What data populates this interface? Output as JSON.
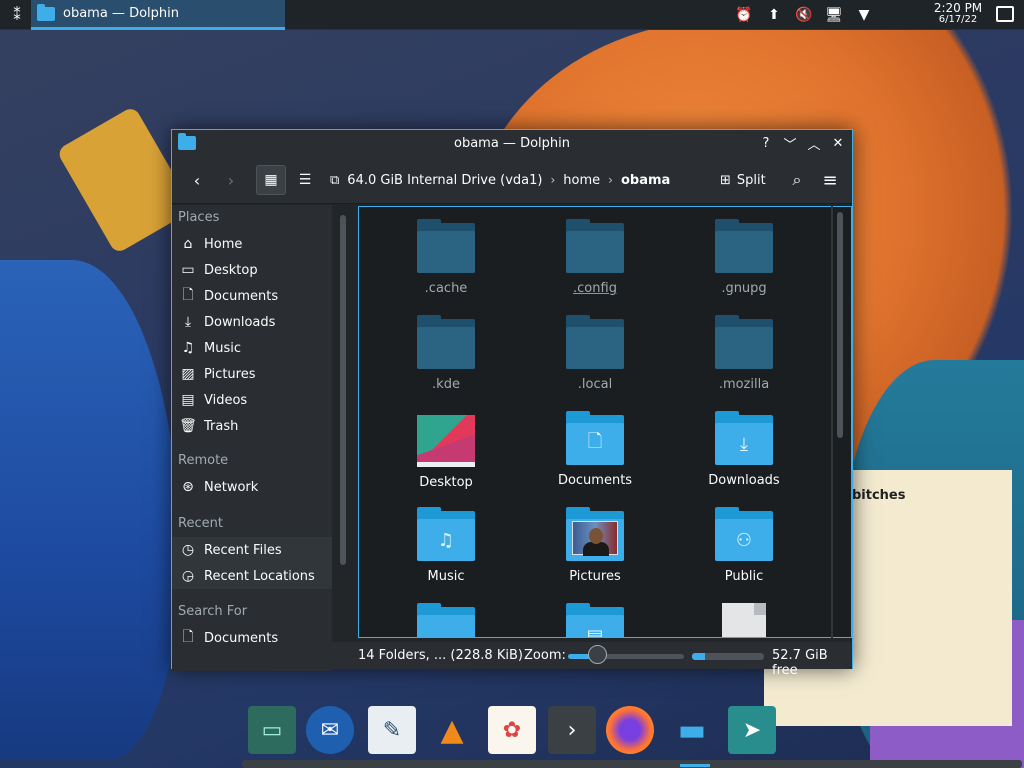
{
  "panel": {
    "task_title": "obama — Dolphin",
    "clock_time": "2:20 PM",
    "clock_date": "6/17/22",
    "tray_icons": [
      "alarm-icon",
      "update-icon",
      "volume-muted-icon",
      "network-icon",
      "expand-icon"
    ]
  },
  "note": {
    "text": "bitches"
  },
  "window": {
    "title": "obama — Dolphin",
    "breadcrumbs": [
      "64.0 GiB Internal Drive (vda1)",
      "home",
      "obama"
    ],
    "split_label": "Split"
  },
  "places": {
    "sections": [
      {
        "title": "Places",
        "items": [
          "Home",
          "Desktop",
          "Documents",
          "Downloads",
          "Music",
          "Pictures",
          "Videos",
          "Trash"
        ]
      },
      {
        "title": "Remote",
        "items": [
          "Network"
        ]
      },
      {
        "title": "Recent",
        "items": [
          "Recent Files",
          "Recent Locations"
        ]
      },
      {
        "title": "Search For",
        "items": [
          "Documents"
        ]
      }
    ]
  },
  "files": [
    {
      "name": ".cache",
      "kind": "hidden-folder"
    },
    {
      "name": ".config",
      "kind": "hidden-folder"
    },
    {
      "name": ".gnupg",
      "kind": "hidden-folder"
    },
    {
      "name": ".kde",
      "kind": "hidden-folder"
    },
    {
      "name": ".local",
      "kind": "hidden-folder"
    },
    {
      "name": ".mozilla",
      "kind": "hidden-folder"
    },
    {
      "name": "Desktop",
      "kind": "desktop-folder"
    },
    {
      "name": "Documents",
      "kind": "documents-folder"
    },
    {
      "name": "Downloads",
      "kind": "downloads-folder"
    },
    {
      "name": "Music",
      "kind": "music-folder"
    },
    {
      "name": "Pictures",
      "kind": "pictures-folder"
    },
    {
      "name": "Public",
      "kind": "public-folder"
    }
  ],
  "status": {
    "summary": "14 Folders, ... (228.8 KiB)",
    "zoom_label": "Zoom:",
    "zoom_level": 0.25,
    "free_space": "52.7 GiB free",
    "disk_used_fraction": 0.18
  },
  "dock": [
    "cassette-app-icon",
    "thunderbird-icon",
    "text-editor-icon",
    "vlc-icon",
    "notes-icon",
    "terminal-icon",
    "firefox-icon",
    "dolphin-icon",
    "discover-icon"
  ],
  "colors": {
    "accent": "#3daee9",
    "window_bg": "#232629",
    "view_bg": "#1b1e20"
  }
}
